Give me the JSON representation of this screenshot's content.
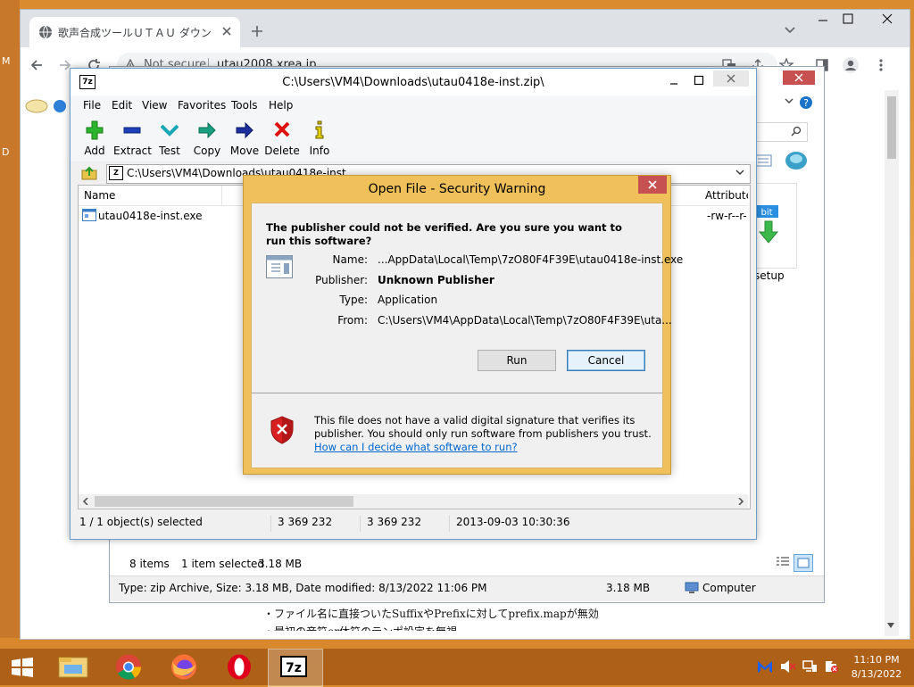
{
  "desktop": {
    "left_labels": [
      "M",
      "D"
    ]
  },
  "browser": {
    "tab_title": "歌声合成ツールＵＴＡＵ ダウンロー",
    "address_security": "Not secure",
    "address_url": "utau2008.xrea.jp",
    "page_lines": [
      "・ファイル名に直接ついたSuffixやPrefixに対してprefix.mapが無効",
      "・最初の音符or休符のテンポ設定を無視"
    ]
  },
  "explorer": {
    "status_items": "8 items",
    "status_selected": "1 item selected",
    "status_size": "3.18 MB",
    "details": "Type: zip Archive, Size: 3.18 MB, Date modified: 8/13/2022 11:06 PM",
    "details_size": "3.18 MB",
    "details_location": "Computer",
    "file_label": "setup"
  },
  "sevenzip": {
    "title": "C:\\Users\\VM4\\Downloads\\utau0418e-inst.zip\\",
    "menu": [
      "File",
      "Edit",
      "View",
      "Favorites",
      "Tools",
      "Help"
    ],
    "toolbar": [
      {
        "label": "Add",
        "icon": "add-icon"
      },
      {
        "label": "Extract",
        "icon": "extract-icon"
      },
      {
        "label": "Test",
        "icon": "test-icon"
      },
      {
        "label": "Copy",
        "icon": "copy-icon"
      },
      {
        "label": "Move",
        "icon": "move-icon"
      },
      {
        "label": "Delete",
        "icon": "delete-icon"
      },
      {
        "label": "Info",
        "icon": "info-icon"
      }
    ],
    "address": "C:\\Users\\VM4\\Downloads\\utau0418e-inst.zip\\",
    "columns": {
      "name": "Name",
      "attributes": "Attributes"
    },
    "rows": [
      {
        "name": "utau0418e-inst.exe",
        "attributes": "-rw-r--r-"
      }
    ],
    "status": {
      "selected": "1 / 1 object(s) selected",
      "size": "3 369 232",
      "packed": "3 369 232",
      "modified": "2013-09-03 10:30:36"
    }
  },
  "dialog": {
    "title": "Open File - Security Warning",
    "question": "The publisher could not be verified.  Are you sure you want to run this software?",
    "fields": [
      {
        "label": "Name:",
        "value": "...AppData\\Local\\Temp\\7zO80F4F39E\\utau0418e-inst.exe"
      },
      {
        "label": "Publisher:",
        "value": "Unknown Publisher"
      },
      {
        "label": "Type:",
        "value": "Application"
      },
      {
        "label": "From:",
        "value": "C:\\Users\\VM4\\AppData\\Local\\Temp\\7zO80F4F39E\\uta..."
      }
    ],
    "run_label": "Run",
    "cancel_label": "Cancel",
    "warning_line1": "This file does not have a valid digital signature that verifies its",
    "warning_line2": "publisher.  You should only run software from publishers you trust.",
    "help_link": "How can I decide what software to run?"
  },
  "taskbar": {
    "time": "11:10 PM",
    "date": "8/13/2022"
  },
  "colors": {
    "dialog_frame": "#f0c15a",
    "close_red": "#c75050",
    "link": "#0066cc",
    "taskbar": "#a45812"
  }
}
